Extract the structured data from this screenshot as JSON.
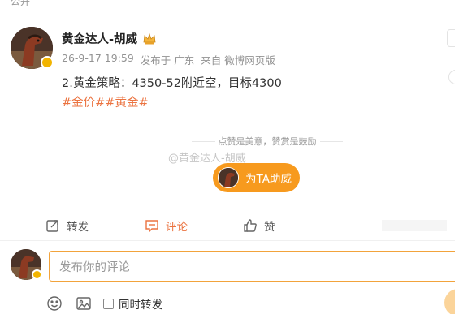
{
  "top_partial": "公开",
  "post": {
    "username": "黄金达人-胡威",
    "meta": {
      "time": "26-9-17 19:59",
      "published_in": "发布于 广东",
      "source": "来自 微博网页版"
    },
    "content": "2.黄金策略：4350-52附近空，目标4300",
    "topics": "#金价##黄金#",
    "like_line": "点赞是美意，赞赏是鼓励",
    "watermark": "@黄金达人-胡威",
    "support_button": "为TA助威"
  },
  "actions": {
    "repost": "转发",
    "comment": "评论",
    "like": "赞"
  },
  "comment_editor": {
    "placeholder": "发布你的评论",
    "repost_checkbox": "同时转发"
  },
  "colors": {
    "accent": "#eb7340",
    "support_button": "#f79a1e",
    "input_border": "#f2a33b",
    "verified_badge": "#f2b400"
  },
  "icons": [
    "crown-icon",
    "verified-badge-icon",
    "repost-icon",
    "comment-icon",
    "like-icon",
    "emoji-icon",
    "image-icon"
  ]
}
